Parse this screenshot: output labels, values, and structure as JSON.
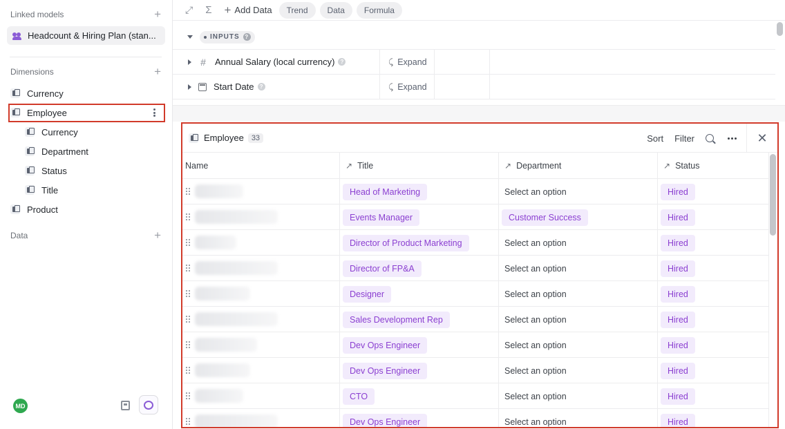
{
  "sidebar": {
    "linked_models_label": "Linked models",
    "linked_model": "Headcount & Hiring Plan (stan...",
    "dimensions_label": "Dimensions",
    "dimensions": [
      {
        "label": "Currency"
      },
      {
        "label": "Employee"
      },
      {
        "label": "Currency"
      },
      {
        "label": "Department"
      },
      {
        "label": "Status"
      },
      {
        "label": "Title"
      },
      {
        "label": "Product"
      }
    ],
    "data_label": "Data",
    "plus": "+",
    "avatar_initials": "MD"
  },
  "toolbar": {
    "add_data": "Add Data",
    "chips": [
      "Trend",
      "Data",
      "Formula"
    ]
  },
  "inputs": {
    "section_label": "INPUTS",
    "rows": [
      {
        "name": "Annual Salary (local currency)",
        "expand": "Expand"
      },
      {
        "name": "Start Date",
        "expand": "Expand"
      }
    ]
  },
  "panel": {
    "title": "Employee",
    "count": "33",
    "actions": {
      "sort": "Sort",
      "filter": "Filter"
    },
    "columns": {
      "name": "Name",
      "title": "Title",
      "department": "Department",
      "status": "Status"
    },
    "rows": [
      {
        "title": "Head of Marketing",
        "department": "Select an option",
        "status": "Hired"
      },
      {
        "title": "Events Manager",
        "department": "Customer Success",
        "status": "Hired"
      },
      {
        "title": "Director of Product Marketing",
        "department": "Select an option",
        "status": "Hired"
      },
      {
        "title": "Director of FP&A",
        "department": "Select an option",
        "status": "Hired"
      },
      {
        "title": "Designer",
        "department": "Select an option",
        "status": "Hired"
      },
      {
        "title": "Sales Development Rep",
        "department": "Select an option",
        "status": "Hired"
      },
      {
        "title": "Dev Ops Engineer",
        "department": "Select an option",
        "status": "Hired"
      },
      {
        "title": "Dev Ops Engineer",
        "department": "Select an option",
        "status": "Hired"
      },
      {
        "title": "CTO",
        "department": "Select an option",
        "status": "Hired"
      },
      {
        "title": "Dev Ops Engineer",
        "department": "Select an option",
        "status": "Hired"
      }
    ]
  },
  "colors": {
    "tag_bg": "#f2ebfc",
    "tag_text": "#8b3fd1",
    "highlight": "#d13a2a",
    "avatar": "#2fa84f"
  }
}
